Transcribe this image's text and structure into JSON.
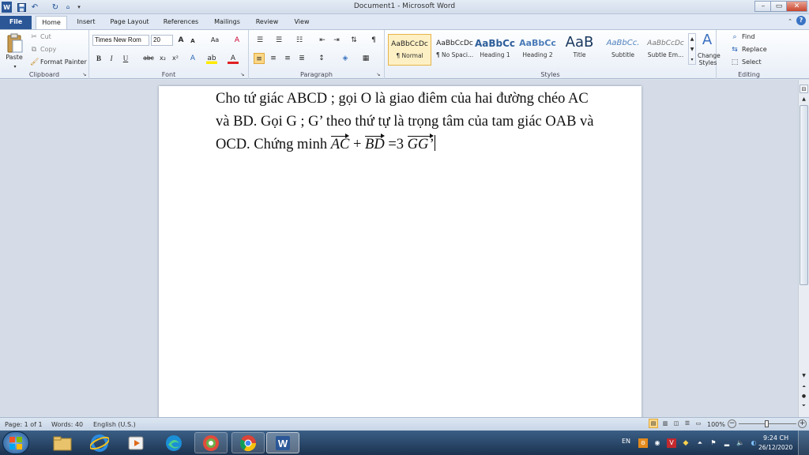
{
  "window": {
    "title": "Document1 - Microsoft Word"
  },
  "qat": {
    "word_icon": "W",
    "save_icon": "save-icon",
    "undo_icon": "undo-icon",
    "redo_icon": "redo-icon",
    "customize_icon": "customize-icon"
  },
  "window_controls": {
    "minimize": "–",
    "maximize": "▭",
    "close": "✕"
  },
  "tabs": [
    "File",
    "Home",
    "Insert",
    "Page Layout",
    "References",
    "Mailings",
    "Review",
    "View"
  ],
  "clipboard": {
    "paste": "Paste",
    "cut": "Cut",
    "copy": "Copy",
    "format_painter": "Format Painter",
    "label": "Clipboard"
  },
  "font": {
    "name": "Times New Rom",
    "size": "20",
    "grow": "A",
    "shrink": "A",
    "case": "Aa",
    "clear": "A",
    "bold": "B",
    "italic": "I",
    "underline": "U",
    "strike": "abc",
    "sub": "x₂",
    "sup": "x²",
    "effects": "A",
    "highlight": "ab",
    "color": "A",
    "label": "Font"
  },
  "paragraph": {
    "label": "Paragraph",
    "pilcrow": "¶"
  },
  "styles": {
    "label": "Styles",
    "items": [
      {
        "preview": "AaBbCcDc",
        "name": "¶ Normal"
      },
      {
        "preview": "AaBbCcDc",
        "name": "¶ No Spaci..."
      },
      {
        "preview": "AaBbCc",
        "name": "Heading 1"
      },
      {
        "preview": "AaBbCc",
        "name": "Heading 2"
      },
      {
        "preview": "AaB",
        "name": "Title"
      },
      {
        "preview": "AaBbCc.",
        "name": "Subtitle"
      },
      {
        "preview": "AaBbCcDc",
        "name": "Subtle Em..."
      }
    ],
    "change_styles_line1": "Change",
    "change_styles_line2": "Styles"
  },
  "editing": {
    "find": "Find",
    "replace": "Replace",
    "select": "Select",
    "label": "Editing"
  },
  "document": {
    "text_before": "Cho tứ giác ABCD ; gọi O là giao điêm của hai đường chéo AC  và BD. Gọi  G ; G’ theo thứ tự là trọng tâm của tam giác OAB và OCD. Chứng minh ",
    "vec1": "AC",
    "plus": " + ",
    "vec2": "BD",
    "equals": " =3 ",
    "vec3": "GG’"
  },
  "status": {
    "page": "Page: 1 of 1",
    "words": "Words: 40",
    "language": "English (U.S.)",
    "zoom": "100%"
  },
  "taskbar": {
    "language": "EN",
    "time": "9:24 CH",
    "date": "26/12/2020"
  }
}
